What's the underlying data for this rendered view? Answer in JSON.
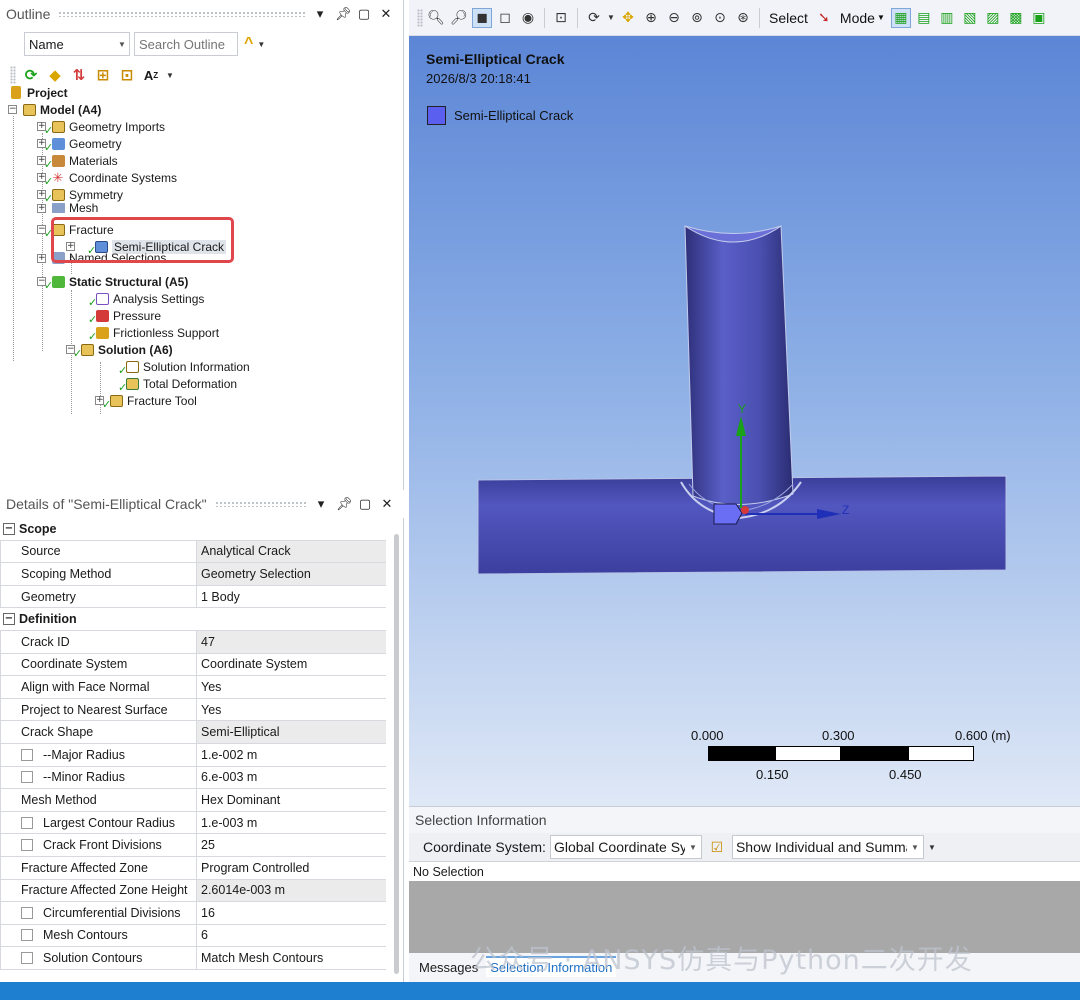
{
  "outline": {
    "title": "Outline",
    "sort_combo": "Name",
    "search_placeholder": "Search Outline",
    "tree": [
      {
        "label": "Project",
        "bold": true
      },
      {
        "label": "Model (A4)",
        "bold": true
      },
      {
        "label": "Geometry Imports"
      },
      {
        "label": "Geometry"
      },
      {
        "label": "Materials"
      },
      {
        "label": "Coordinate Systems"
      },
      {
        "label": "Symmetry"
      },
      {
        "label": "Mesh"
      },
      {
        "label": "Fracture"
      },
      {
        "label": "Semi-Elliptical Crack"
      },
      {
        "label": "Named Selections"
      },
      {
        "label": "Static Structural (A5)",
        "bold": true
      },
      {
        "label": "Analysis Settings"
      },
      {
        "label": "Pressure"
      },
      {
        "label": "Frictionless Support"
      },
      {
        "label": "Solution (A6)",
        "bold": true
      },
      {
        "label": "Solution Information"
      },
      {
        "label": "Total Deformation"
      },
      {
        "label": "Fracture Tool"
      }
    ]
  },
  "details": {
    "title": "Details of \"Semi-Elliptical Crack\"",
    "scope_header": "Scope",
    "definition_header": "Definition",
    "scope_rows": [
      {
        "key": "Source",
        "value": "Analytical Crack"
      },
      {
        "key": "Scoping Method",
        "value": "Geometry Selection"
      },
      {
        "key": "Geometry",
        "value": "1 Body"
      }
    ],
    "definition_rows": [
      {
        "key": "Crack ID",
        "value": "47"
      },
      {
        "key": "Coordinate System",
        "value": "Coordinate System"
      },
      {
        "key": "Align with Face Normal",
        "value": "Yes"
      },
      {
        "key": "Project to Nearest Surface",
        "value": "Yes"
      },
      {
        "key": "Crack Shape",
        "value": "Semi-Elliptical"
      },
      {
        "key": "--Major Radius",
        "value": "1.e-002 m"
      },
      {
        "key": "--Minor Radius",
        "value": "6.e-003 m"
      },
      {
        "key": "Mesh Method",
        "value": "Hex Dominant"
      },
      {
        "key": "Largest Contour Radius",
        "value": "1.e-003 m"
      },
      {
        "key": "Crack Front Divisions",
        "value": "25"
      },
      {
        "key": "Fracture Affected Zone",
        "value": "Program Controlled"
      },
      {
        "key": "Fracture Affected Zone Height",
        "value": "2.6014e-003 m"
      },
      {
        "key": "Circumferential Divisions",
        "value": "16"
      },
      {
        "key": "Mesh Contours",
        "value": "6"
      },
      {
        "key": "Solution Contours",
        "value": "Match Mesh Contours"
      }
    ]
  },
  "graphics_toolbar": {
    "select_label": "Select",
    "mode_label": "Mode"
  },
  "viewport": {
    "title": "Semi-Elliptical Crack",
    "timestamp": "2026/8/3 20:18:41",
    "legend_label": "Semi-Elliptical Crack",
    "legend_color": "#5a5ff0",
    "axis_y": "Y",
    "axis_z": "Z",
    "scale": {
      "top_labels": [
        "0.000",
        "0.300",
        "0.600 (m)"
      ],
      "bottom_labels": [
        "0.150",
        "0.450"
      ]
    }
  },
  "selection_info": {
    "title": "Selection Information",
    "coord_label": "Coordinate System:",
    "coord_value": "Global Coordinate Sy",
    "show_value": "Show Individual and Summa",
    "no_selection": "No Selection",
    "tabs": [
      "Messages",
      "Selection Information"
    ]
  },
  "watermark": "公众号 · ANSYS仿真与Python二次开发",
  "colors": {
    "status_bar": "#1e7fd1",
    "highlight": "#e0474c",
    "body": "#4a4fb0"
  }
}
